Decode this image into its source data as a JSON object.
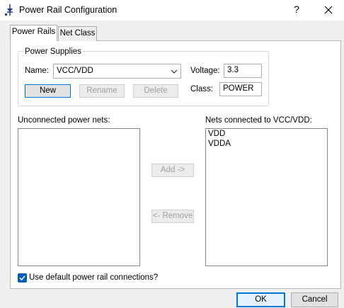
{
  "window": {
    "title": "Power Rail Configuration",
    "help_label": "?"
  },
  "tabs": [
    {
      "label": "Power Rails",
      "active": true
    },
    {
      "label": "Net Class",
      "active": false
    }
  ],
  "power_supplies": {
    "group_title": "Power Supplies",
    "name_label": "Name:",
    "name_value": "VCC/VDD",
    "voltage_label": "Voltage:",
    "voltage_value": "3.3",
    "class_label": "Class:",
    "class_value": "POWER",
    "new_label": "New",
    "rename_label": "Rename",
    "delete_label": "Delete"
  },
  "unconnected": {
    "label": "Unconnected power nets:",
    "items": []
  },
  "connected": {
    "label": "Nets connected to VCC/VDD:",
    "items": [
      "VDD",
      "VDDA"
    ]
  },
  "actions": {
    "add_label": "Add ->",
    "remove_label": "<- Remove"
  },
  "use_default": {
    "label": "Use default power rail connections?",
    "checked": true
  },
  "footer": {
    "ok_label": "OK",
    "cancel_label": "Cancel"
  },
  "colors": {
    "accent": "#0078d7",
    "checkbox": "#005fb8"
  }
}
